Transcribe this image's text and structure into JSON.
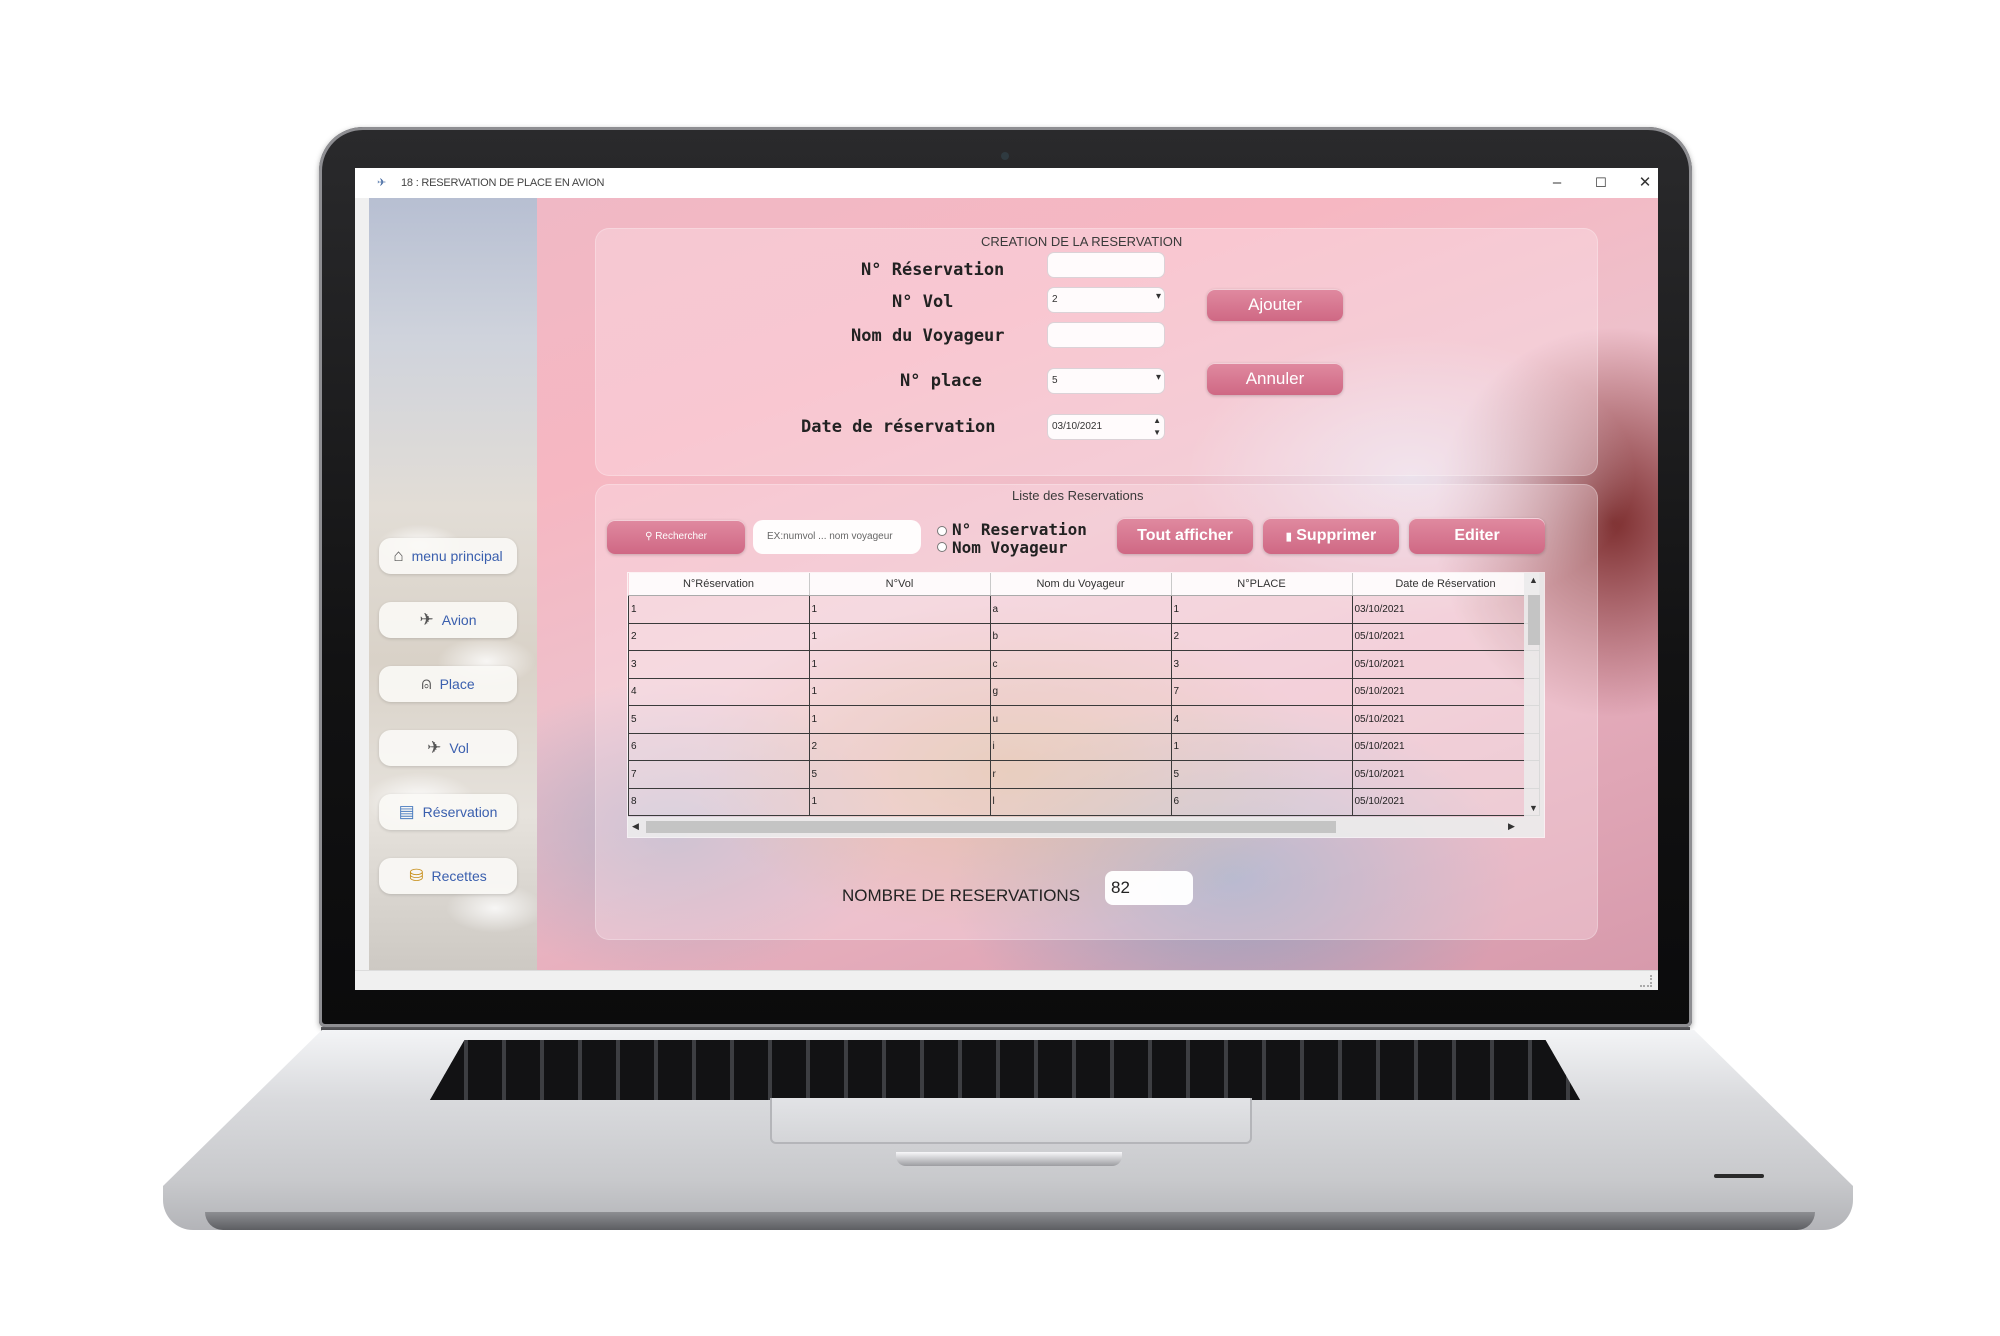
{
  "window": {
    "title": "18 : RESERVATION DE PLACE EN AVION",
    "minimize": "–",
    "maximize": "☐",
    "close": "✕"
  },
  "sidebar": {
    "items": [
      {
        "label": "menu principal",
        "icon": "home-icon",
        "glyph": "⌂"
      },
      {
        "label": "Avion",
        "icon": "airplane-icon",
        "glyph": "✈"
      },
      {
        "label": "Place",
        "icon": "seat-icon",
        "glyph": "⍝"
      },
      {
        "label": "Vol",
        "icon": "flight-icon",
        "glyph": "✈"
      },
      {
        "label": "Réservation",
        "icon": "reservation-icon",
        "glyph": "▤"
      },
      {
        "label": "Recettes",
        "icon": "coins-icon",
        "glyph": "⛁"
      }
    ]
  },
  "creation": {
    "title": "CREATION DE LA RESERVATION",
    "labels": {
      "num_reservation": "N° Réservation",
      "num_vol": "N° Vol",
      "nom_voyageur": "Nom du Voyageur",
      "num_place": "N° place",
      "date_reservation": "Date de réservation"
    },
    "values": {
      "num_reservation": "",
      "num_vol": "2",
      "nom_voyageur": "",
      "num_place": "5",
      "date_reservation": "03/10/2021"
    },
    "buttons": {
      "ajouter": "Ajouter",
      "annuler": "Annuler"
    }
  },
  "liste": {
    "title": "Liste des Reservations",
    "search_button": "Rechercher",
    "search_placeholder": "EX:numvol ... nom voyageur",
    "radio_reservation": "N° Reservation",
    "radio_nom": "Nom Voyageur",
    "tout_afficher": "Tout afficher",
    "supprimer": "Supprimer",
    "editer": "Editer",
    "columns": [
      "N°Réservation",
      "N°Vol",
      "Nom du Voyageur",
      "N°PLACE",
      "Date de Réservation"
    ],
    "rows": [
      [
        "1",
        "1",
        "a",
        "1",
        "03/10/2021"
      ],
      [
        "2",
        "1",
        "b",
        "2",
        "05/10/2021"
      ],
      [
        "3",
        "1",
        "c",
        "3",
        "05/10/2021"
      ],
      [
        "4",
        "1",
        "g",
        "7",
        "05/10/2021"
      ],
      [
        "5",
        "1",
        "u",
        "4",
        "05/10/2021"
      ],
      [
        "6",
        "2",
        "i",
        "1",
        "05/10/2021"
      ],
      [
        "7",
        "5",
        "r",
        "5",
        "05/10/2021"
      ],
      [
        "8",
        "1",
        "l",
        "6",
        "05/10/2021"
      ]
    ]
  },
  "footer": {
    "count_label": "NOMBRE DE RESERVATIONS",
    "count_value": "82"
  },
  "colors": {
    "accent": "#d9758f",
    "sidebar_text": "#3a5fae"
  }
}
